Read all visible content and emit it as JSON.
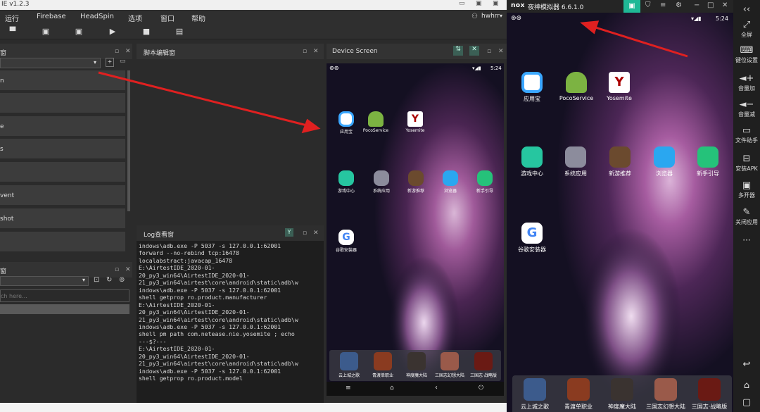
{
  "ide": {
    "title": "IE v1.2.3",
    "menus": [
      "运行",
      "Firebase",
      "HeadSpin",
      "选项",
      "窗口",
      "帮助"
    ],
    "user": "hwhrr",
    "left_panel_title": "窗",
    "tree_items": [
      "n",
      "",
      "e",
      "s",
      "",
      "vent",
      "shot",
      ""
    ],
    "poco_panel_title": "窗",
    "search_placeholder": "ch here...",
    "editor_title": "脚本编辑窗",
    "log_title": "Log查看窗",
    "log_lines": [
      "indows\\adb.exe -P 5037 -s 127.0.0.1:62001",
      "forward --no-rebind tcp:16478",
      "localabstract:javacap_16478",
      "E:\\AirtestIDE_2020-01-",
      "20_py3_win64\\AirtestIDE_2020-01-",
      "21_py3_win64\\airtest\\core\\android\\static\\adb\\w",
      "indows\\adb.exe -P 5037 -s 127.0.0.1:62001",
      "shell getprop ro.product.manufacturer",
      "E:\\AirtestIDE_2020-01-",
      "20_py3_win64\\AirtestIDE_2020-01-",
      "21_py3_win64\\airtest\\core\\android\\static\\adb\\w",
      "indows\\adb.exe -P 5037 -s 127.0.0.1:62001",
      "shell pm path com.netease.nie.yosemite ; echo",
      "---$?---",
      "E:\\AirtestIDE_2020-01-",
      "20_py3_win64\\AirtestIDE_2020-01-",
      "21_py3_win64\\airtest\\core\\android\\static\\adb\\w",
      "indows\\adb.exe -P 5037 -s 127.0.0.1:62001",
      "shell getprop ro.product.model"
    ],
    "device_title": "Device Screen"
  },
  "phone": {
    "time": "5:24",
    "apps_row1": [
      "应用宝",
      "PocoService",
      "Yosemite"
    ],
    "apps_row2": [
      "游戏中心",
      "系统应用",
      "新游推荐",
      "浏览器",
      "新手引导"
    ],
    "app_google": "谷歌安装器",
    "dock": [
      "云上城之歌",
      "青渡单职业",
      "神度魔大陆",
      "三国志幻想大陆",
      "三国志·战略版"
    ]
  },
  "nox": {
    "logo": "nox",
    "title": "夜神模拟器 6.6.1.0",
    "sidebar": [
      "全屏",
      "键位设置",
      "音量加",
      "音量减",
      "文件助手",
      "安装APK",
      "多开器",
      "关闭应用"
    ],
    "more": "···"
  },
  "colors": {
    "arrow": "#e02020",
    "nox_accent": "#1fb896"
  }
}
